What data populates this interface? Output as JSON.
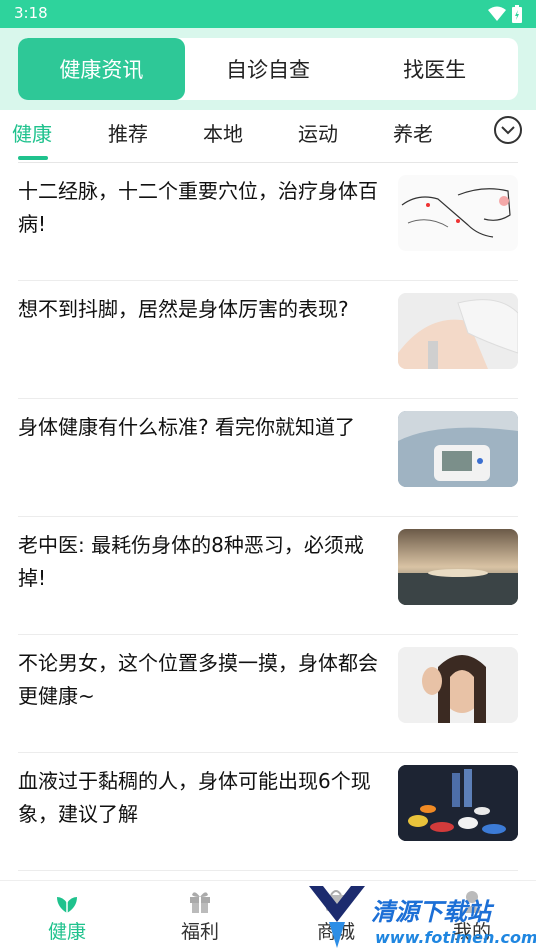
{
  "status": {
    "time": "3:18"
  },
  "segments": [
    {
      "label": "健康资讯",
      "active": true
    },
    {
      "label": "自诊自查",
      "active": false
    },
    {
      "label": "找医生",
      "active": false
    }
  ],
  "categories": [
    {
      "label": "健康",
      "active": true
    },
    {
      "label": "推荐",
      "active": false
    },
    {
      "label": "本地",
      "active": false
    },
    {
      "label": "运动",
      "active": false
    },
    {
      "label": "养老",
      "active": false
    }
  ],
  "news": [
    {
      "title": "十二经脉，十二个重要穴位，治疗身体百病!",
      "thumb": "acupoint-hand-sketch"
    },
    {
      "title": "想不到抖脚，居然是身体厉害的表现?",
      "thumb": "legs-photo"
    },
    {
      "title": "身体健康有什么标准? 看完你就知道了",
      "thumb": "blood-pressure-monitor-photo"
    },
    {
      "title": "老中医: 最耗伤身体的8种恶习，必须戒掉!",
      "thumb": "sea-sunset-photo"
    },
    {
      "title": "不论男女，这个位置多摸一摸，身体都会更健康~",
      "thumb": "woman-listening-photo"
    },
    {
      "title": "血液过于黏稠的人，身体可能出现6个现象，建议了解",
      "thumb": "pills-photo"
    }
  ],
  "nav": [
    {
      "label": "健康",
      "icon": "leaf-icon",
      "active": true
    },
    {
      "label": "福利",
      "icon": "gift-icon",
      "active": false
    },
    {
      "label": "商城",
      "icon": "shop-icon",
      "active": false
    },
    {
      "label": "我的",
      "icon": "profile-icon",
      "active": false
    }
  ],
  "watermark": {
    "text": "清源下载站",
    "url": "www.fotimen.com"
  },
  "colors": {
    "accent": "#2ec897",
    "status_bar": "#2ed39c",
    "header_bg": "#d9f7ec"
  }
}
